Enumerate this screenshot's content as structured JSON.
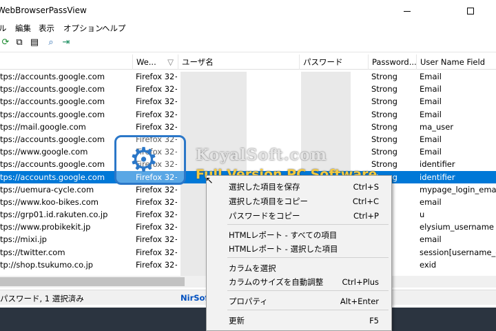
{
  "window": {
    "title": "WebBrowserPassView",
    "maximize_glyph": "☐"
  },
  "menu": [
    "ル",
    "編集",
    "表示",
    "オプション",
    "ヘルプ"
  ],
  "toolbar_icons": [
    "refresh-icon",
    "copy-icon",
    "properties-icon",
    "find-icon",
    "exit-icon"
  ],
  "columns": [
    {
      "label": "",
      "name": "url-column"
    },
    {
      "label": "We...",
      "name": "web-browser-column"
    },
    {
      "label": "ユーザ名",
      "name": "username-column"
    },
    {
      "label": "パスワード",
      "name": "password-column"
    },
    {
      "label": "Password...",
      "name": "password-strength-column"
    },
    {
      "label": "User Name Field",
      "name": "user-name-field-column"
    }
  ],
  "sort_arrow": "▽",
  "rows": [
    {
      "url": "tps://accounts.google.com",
      "browser": "Firefox 32+",
      "strength": "Strong",
      "field": "Email"
    },
    {
      "url": "tps://accounts.google.com",
      "browser": "Firefox 32+",
      "strength": "Strong",
      "field": "Email"
    },
    {
      "url": "tps://accounts.google.com",
      "browser": "Firefox 32+",
      "strength": "Strong",
      "field": "Email"
    },
    {
      "url": "tps://accounts.google.com",
      "browser": "Firefox 32+",
      "strength": "Strong",
      "field": "Email"
    },
    {
      "url": "tps://mail.google.com",
      "browser": "Firefox 32+",
      "strength": "Strong",
      "field": "ma_user"
    },
    {
      "url": "tps://accounts.google.com",
      "browser": "Firefox 32+",
      "strength": "Strong",
      "field": "Email"
    },
    {
      "url": "tps://www.google.com",
      "browser": "Firefox 32+",
      "strength": "Strong",
      "field": "Email"
    },
    {
      "url": "tps://accounts.google.com",
      "browser": "Firefox 32+",
      "strength": "Strong",
      "field": "identifier"
    },
    {
      "url": "tps://accounts.google.com",
      "browser": "Firefox 32+",
      "strength": "Strong",
      "field": "identifier",
      "selected": true
    },
    {
      "url": "tps://uemura-cycle.com",
      "browser": "Firefox 32+",
      "strength": "",
      "field": "mypage_login_email"
    },
    {
      "url": "tps://www.koo-bikes.com",
      "browser": "Firefox 32+",
      "strength": "ng",
      "field": "email"
    },
    {
      "url": "tps://grp01.id.rakuten.co.jp",
      "browser": "Firefox 32+",
      "strength": "ng",
      "field": "u"
    },
    {
      "url": "tps://www.probikekit.jp",
      "browser": "Firefox 32+",
      "strength": "",
      "field": "elysium_username"
    },
    {
      "url": "tps://mixi.jp",
      "browser": "Firefox 32+",
      "strength": "ng",
      "field": "email"
    },
    {
      "url": "tps://twitter.com",
      "browser": "Firefox 32+",
      "strength": "ng",
      "field": "session[username_or_"
    },
    {
      "url": "tp://shop.tsukumo.co.jp",
      "browser": "Firefox 32+",
      "strength": "ng",
      "field": "exid"
    }
  ],
  "status": {
    "left": "パスワード, 1 選択済み",
    "middle": "NirSoft"
  },
  "context_menu": [
    {
      "label": "選択した項目を保存",
      "shortcut": "Ctrl+S",
      "name": "save-selected-item"
    },
    {
      "label": "選択した項目をコピー",
      "shortcut": "Ctrl+C",
      "name": "copy-selected-item"
    },
    {
      "label": "パスワードをコピー",
      "shortcut": "Ctrl+P",
      "name": "copy-password"
    },
    {
      "label": "HTMLレポート - すべての項目",
      "shortcut": "",
      "name": "html-report-all"
    },
    {
      "label": "HTMLレポート - 選択した項目",
      "shortcut": "",
      "name": "html-report-selected"
    },
    {
      "label": "カラムを選択",
      "shortcut": "",
      "name": "choose-columns"
    },
    {
      "label": "カラムのサイズを自動調整",
      "shortcut": "Ctrl+Plus",
      "name": "auto-size-columns"
    },
    {
      "label": "プロパティ",
      "shortcut": "Alt+Enter",
      "name": "properties"
    },
    {
      "label": "更新",
      "shortcut": "F5",
      "name": "refresh"
    }
  ],
  "watermark": {
    "line1": "KoyalSoft.com",
    "line2": "Full Version PC Software"
  },
  "colors": {
    "selection": "#0078d7",
    "accent": "#2b77c8",
    "nirsoft_link": "#0050c0"
  }
}
